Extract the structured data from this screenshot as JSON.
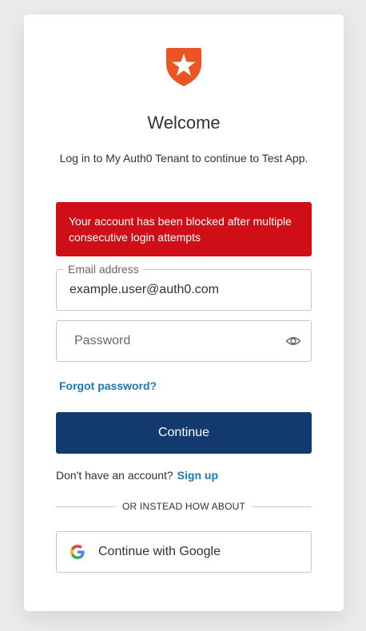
{
  "header": {
    "title": "Welcome",
    "subtitle": "Log in to My Auth0 Tenant to continue to Test App."
  },
  "error": {
    "message": "Your account has been blocked after multiple consecutive login attempts"
  },
  "email": {
    "label": "Email address",
    "value": "example.user@auth0.com"
  },
  "password": {
    "placeholder": "Password",
    "toggle_icon": "eye-icon"
  },
  "links": {
    "forgot_password": "Forgot password?",
    "signup_prompt": "Don't have an account?",
    "signup": "Sign up"
  },
  "buttons": {
    "continue": "Continue",
    "google": "Continue with Google"
  },
  "divider": {
    "text": "OR INSTEAD HOW ABOUT"
  },
  "colors": {
    "brand": "#eb5424",
    "primary_button": "#133a6e",
    "error": "#d00e17",
    "link": "#1e76b6"
  }
}
